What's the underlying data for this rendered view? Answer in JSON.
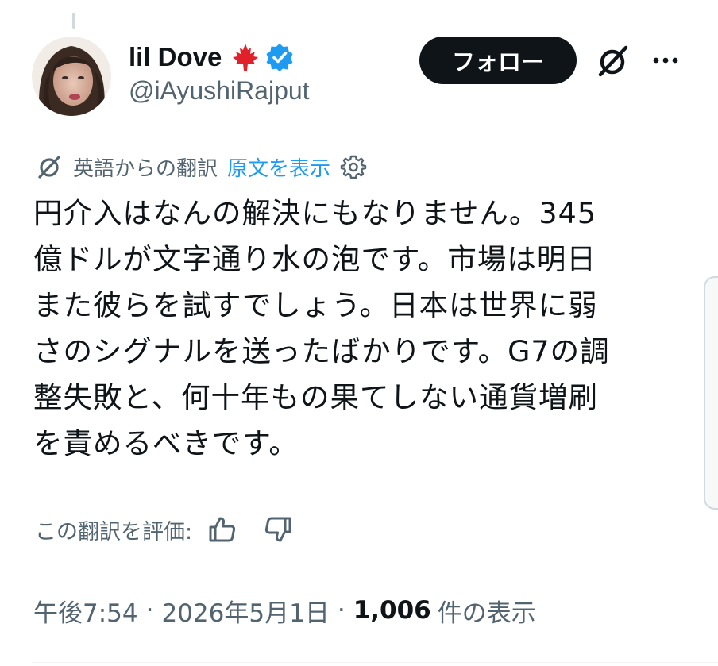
{
  "author": {
    "display_name": "lil Dove",
    "handle": "@iAyushiRajput",
    "flag_icon": "canada-maple-leaf-icon",
    "verified_icon": "verified-badge-icon",
    "verified_color": "#1d9bf0"
  },
  "header": {
    "follow_label": "フォロー",
    "grok_icon": "grok-icon",
    "more_icon": "more-dots-icon"
  },
  "translation": {
    "translated_from": "英語からの翻訳",
    "show_original": "原文を表示",
    "link_color": "#1d9bf0",
    "settings_icon": "gear-icon"
  },
  "tweet": {
    "lines": [
      "円介入はなんの解決にもなりません。345",
      "億ドルが文字通り水の泡です。市場は明日",
      "また彼らを試すでしょう。日本は世界に弱",
      "さのシグナルを送ったばかりです。G7の調",
      "整失敗と、何十年もの果てしない通貨増刷",
      "を責めるべきです。"
    ]
  },
  "rating": {
    "label": "この翻訳を評価:",
    "up_icon": "thumbs-up-icon",
    "down_icon": "thumbs-down-icon"
  },
  "meta": {
    "time": "午後7:54",
    "separator": "·",
    "date": "2026年5月1日",
    "views_count": "1,006",
    "views_label": "件の表示"
  }
}
